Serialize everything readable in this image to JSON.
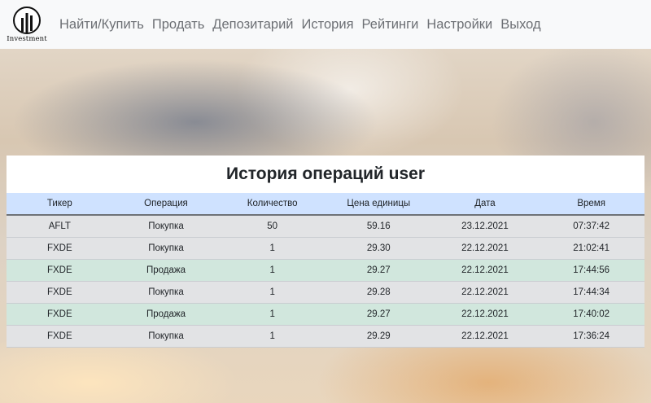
{
  "brand": {
    "name": "Investment",
    "icon": "investment-logo-icon"
  },
  "nav": {
    "items": [
      {
        "label": "Найти/Купить"
      },
      {
        "label": "Продать"
      },
      {
        "label": "Депозитарий"
      },
      {
        "label": "История"
      },
      {
        "label": "Рейтинги"
      },
      {
        "label": "Настройки"
      },
      {
        "label": "Выход"
      }
    ]
  },
  "history": {
    "title": "История операций user",
    "columns": [
      "Тикер",
      "Операция",
      "Количество",
      "Цена единицы",
      "Дата",
      "Время"
    ],
    "rows": [
      {
        "ticker": "AFLT",
        "operation": "Покупка",
        "quantity": "50",
        "price": "59.16",
        "date": "23.12.2021",
        "time": "07:37:42",
        "type": "buy"
      },
      {
        "ticker": "FXDE",
        "operation": "Покупка",
        "quantity": "1",
        "price": "29.30",
        "date": "22.12.2021",
        "time": "21:02:41",
        "type": "buy"
      },
      {
        "ticker": "FXDE",
        "operation": "Продажа",
        "quantity": "1",
        "price": "29.27",
        "date": "22.12.2021",
        "time": "17:44:56",
        "type": "sell"
      },
      {
        "ticker": "FXDE",
        "operation": "Покупка",
        "quantity": "1",
        "price": "29.28",
        "date": "22.12.2021",
        "time": "17:44:34",
        "type": "buy"
      },
      {
        "ticker": "FXDE",
        "operation": "Продажа",
        "quantity": "1",
        "price": "29.27",
        "date": "22.12.2021",
        "time": "17:40:02",
        "type": "sell"
      },
      {
        "ticker": "FXDE",
        "operation": "Покупка",
        "quantity": "1",
        "price": "29.29",
        "date": "22.12.2021",
        "time": "17:36:24",
        "type": "buy"
      }
    ]
  },
  "colors": {
    "navbar_bg": "#f8f9fa",
    "table_header_bg": "#cfe2ff",
    "buy_row_bg": "#e2e3e5",
    "sell_row_bg": "#d1e7dd"
  }
}
